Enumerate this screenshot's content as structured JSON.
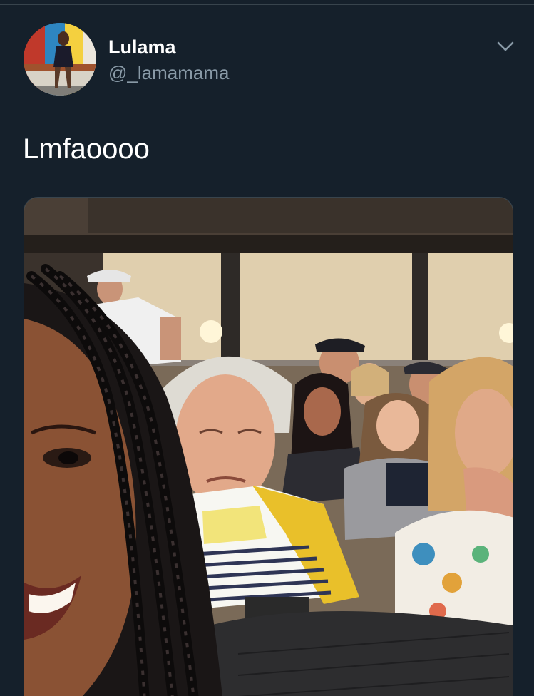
{
  "author": {
    "display_name": "Lulama",
    "handle": "@_lamamama",
    "avatar_icon": "profile-photo"
  },
  "tweet": {
    "text": "Lmfaoooo"
  },
  "controls": {
    "more_icon": "chevron-down-icon"
  },
  "media": {
    "kind": "photo",
    "subject": "stadium-crowd-selfie"
  },
  "colors": {
    "background": "#15202b",
    "primary_text": "#ffffff",
    "secondary_text": "#8899a6",
    "divider": "#38444d"
  }
}
